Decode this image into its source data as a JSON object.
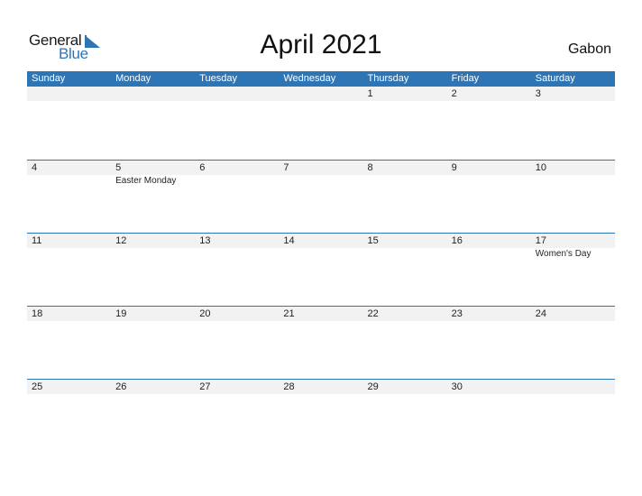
{
  "logo": {
    "general": "General",
    "blue": "Blue"
  },
  "title": "April 2021",
  "country": "Gabon",
  "colors": {
    "accent": "#2e75b6",
    "strip": "#f2f2f2"
  },
  "weekdays": [
    "Sunday",
    "Monday",
    "Tuesday",
    "Wednesday",
    "Thursday",
    "Friday",
    "Saturday"
  ],
  "weeks": [
    [
      {
        "d": ""
      },
      {
        "d": ""
      },
      {
        "d": ""
      },
      {
        "d": ""
      },
      {
        "d": "1"
      },
      {
        "d": "2"
      },
      {
        "d": "3"
      }
    ],
    [
      {
        "d": "4"
      },
      {
        "d": "5",
        "h": "Easter Monday"
      },
      {
        "d": "6"
      },
      {
        "d": "7"
      },
      {
        "d": "8"
      },
      {
        "d": "9"
      },
      {
        "d": "10"
      }
    ],
    [
      {
        "d": "11"
      },
      {
        "d": "12"
      },
      {
        "d": "13"
      },
      {
        "d": "14"
      },
      {
        "d": "15"
      },
      {
        "d": "16"
      },
      {
        "d": "17",
        "h": "Women's Day"
      }
    ],
    [
      {
        "d": "18"
      },
      {
        "d": "19"
      },
      {
        "d": "20"
      },
      {
        "d": "21"
      },
      {
        "d": "22"
      },
      {
        "d": "23"
      },
      {
        "d": "24"
      }
    ],
    [
      {
        "d": "25"
      },
      {
        "d": "26"
      },
      {
        "d": "27"
      },
      {
        "d": "28"
      },
      {
        "d": "29"
      },
      {
        "d": "30"
      },
      {
        "d": ""
      }
    ]
  ]
}
